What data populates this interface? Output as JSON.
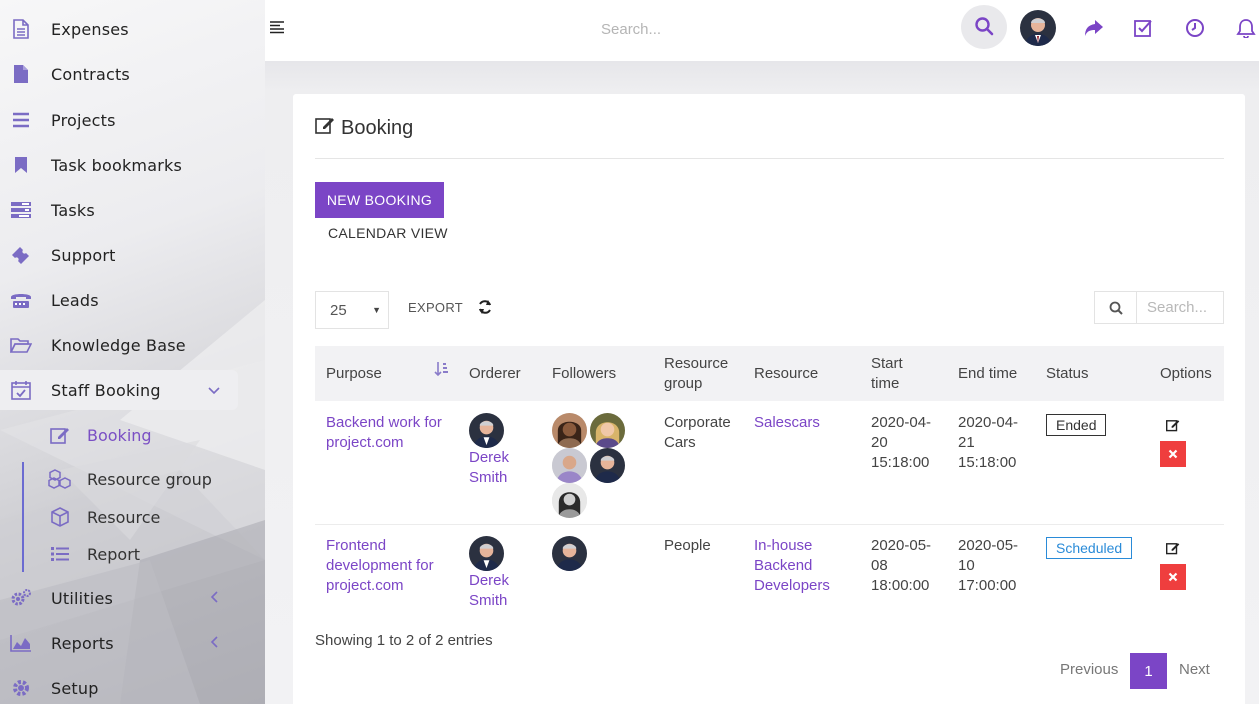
{
  "sidebar": {
    "items": [
      {
        "label": "Expenses",
        "icon": "file-text-icon"
      },
      {
        "label": "Contracts",
        "icon": "file-icon"
      },
      {
        "label": "Projects",
        "icon": "bars-icon"
      },
      {
        "label": "Task bookmarks",
        "icon": "bookmark-icon"
      },
      {
        "label": "Tasks",
        "icon": "tasks-icon"
      },
      {
        "label": "Support",
        "icon": "ticket-icon"
      },
      {
        "label": "Leads",
        "icon": "tty-icon"
      },
      {
        "label": "Knowledge Base",
        "icon": "folder-open-icon"
      },
      {
        "label": "Staff Booking",
        "icon": "calendar-check-icon"
      },
      {
        "label": "Utilities",
        "icon": "cogs-icon"
      },
      {
        "label": "Reports",
        "icon": "area-chart-icon"
      },
      {
        "label": "Setup",
        "icon": "cog-icon"
      }
    ],
    "sub_items": [
      {
        "label": "Booking",
        "icon": "edit-icon"
      },
      {
        "label": "Resource group",
        "icon": "cubes-icon"
      },
      {
        "label": "Resource",
        "icon": "cube-icon"
      },
      {
        "label": "Report",
        "icon": "list-icon"
      }
    ]
  },
  "header": {
    "search_placeholder": "Search..."
  },
  "page": {
    "title": "Booking",
    "new_booking": "NEW BOOKING",
    "calendar_view": "CALENDAR VIEW",
    "page_length": "25",
    "export": "EXPORT",
    "table_search_placeholder": "Search..."
  },
  "table": {
    "columns": [
      "Purpose",
      "Orderer",
      "Followers",
      "Resource group",
      "Resource",
      "Start time",
      "End time",
      "Status",
      "Options"
    ],
    "rows": [
      {
        "purpose": "Backend work for project.com",
        "orderer": "Derek Smith",
        "followers_count": 5,
        "resource_group": "Corporate Cars",
        "resource": "Salescars",
        "start": "2020-04-20 15:18:00",
        "end": "2020-04-21 15:18:00",
        "status": "Ended"
      },
      {
        "purpose": "Frontend development for project.com",
        "orderer": "Derek Smith",
        "followers_count": 1,
        "resource_group": "People",
        "resource": "In-house Backend Developers",
        "start": "2020-05-08 18:00:00",
        "end": "2020-05-10 17:00:00",
        "status": "Scheduled"
      }
    ]
  },
  "footer": {
    "info": "Showing 1 to 2 of 2 entries",
    "previous": "Previous",
    "current_page": "1",
    "next": "Next"
  },
  "colors": {
    "accent": "#7b45c6",
    "danger": "#ef3e3e",
    "scheduled": "#2a8bd8"
  }
}
